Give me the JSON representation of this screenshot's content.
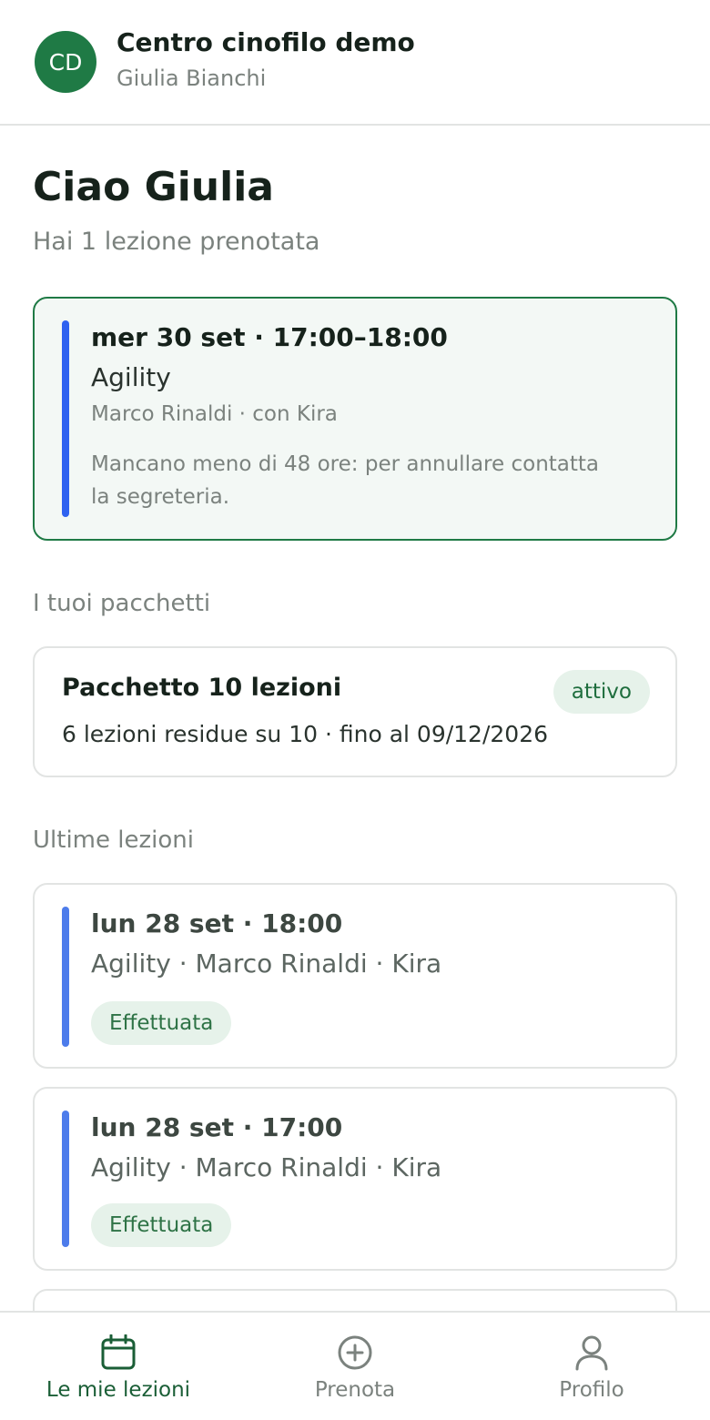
{
  "header": {
    "avatar_initials": "CD",
    "title": "Centro cinofilo demo",
    "user_name": "Giulia Bianchi"
  },
  "greeting": {
    "title": "Ciao Giulia",
    "subtitle": "Hai 1 lezione prenotata"
  },
  "booking": {
    "when": "mer 30 set · 17:00–18:00",
    "course": "Agility",
    "trainer": "Marco Rinaldi · con Kira",
    "note": "Mancano meno di 48 ore: per annullare contatta la segreteria."
  },
  "packages": {
    "section_label": "I tuoi pacchetti",
    "items": [
      {
        "name": "Pacchetto 10 lezioni",
        "badge": "attivo",
        "detail": "6 lezioni residue su 10 · fino al 09/12/2026"
      }
    ]
  },
  "recent": {
    "section_label": "Ultime lezioni",
    "items": [
      {
        "when": "lun 28 set · 18:00",
        "info": "Agility · Marco Rinaldi · Kira",
        "status": "Effettuata"
      },
      {
        "when": "lun 28 set · 17:00",
        "info": "Agility · Marco Rinaldi · Kira",
        "status": "Effettuata"
      }
    ]
  },
  "nav": {
    "items": [
      {
        "label": "Le mie lezioni",
        "icon": "calendar-icon",
        "active": true
      },
      {
        "label": "Prenota",
        "icon": "plus-circle-icon",
        "active": false
      },
      {
        "label": "Profilo",
        "icon": "user-icon",
        "active": false
      }
    ]
  },
  "colors": {
    "brand_green": "#1f7a45",
    "accent_blue": "#2f62f0",
    "badge_bg": "#e6f2ea"
  }
}
